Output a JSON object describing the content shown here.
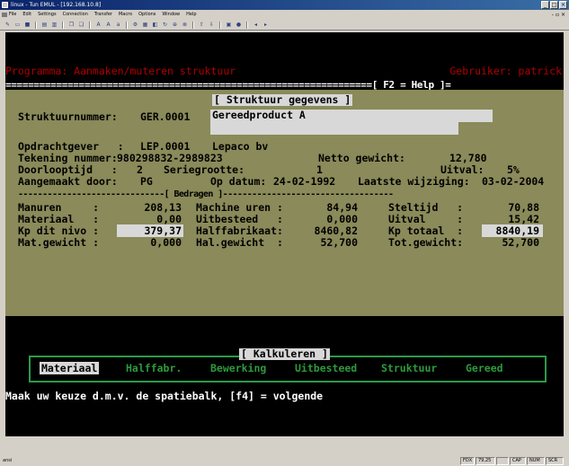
{
  "window": {
    "title": "linux - Tun EMUL - [192.168.10.8]",
    "min_label": "_",
    "max_label": "□",
    "close_label": "×"
  },
  "menubar": {
    "items": [
      "File",
      "Edit",
      "Settings",
      "Connection",
      "Transfer",
      "Macro",
      "Options",
      "Window",
      "Help"
    ],
    "mdi_controls": "- ▫ ×"
  },
  "toolbar": {
    "icons": [
      "new-icon",
      "open-icon",
      "save-icon",
      "print-icon",
      "print-preview-icon",
      "copy-icon",
      "paste-icon",
      "font-icon",
      "bigger-font-icon",
      "smaller-font-icon",
      "settings-icon",
      "keyboard-icon",
      "macro-icon",
      "refresh-icon",
      "connect-icon",
      "disconnect-icon",
      "transfer-icon",
      "receive-icon",
      "screen-icon",
      "record-icon",
      "prev-icon",
      "next-icon"
    ]
  },
  "terminal": {
    "program_line": "Programma: Aanmaken/muteren struktuur",
    "user_line": "Gebruiker: patrick",
    "sep_line": "=================================================================[ F2 = Help ]=",
    "panel_title": "[ Struktuur gegevens ]",
    "struktuur_label": "Struktuurnummer:",
    "struktuur_value": "GER.0001",
    "description": "Gereedproduct A",
    "opdrachtgever_label": "Opdrachtgever   :",
    "opdrachtgever_code": "LEP.0001",
    "opdrachtgever_name": "Lepaco bv",
    "tekening_label": "Tekening nummer:",
    "tekening_value": "980298832-2989823",
    "netto_label": "Netto gewicht:",
    "netto_value": "12,780",
    "doorloop_label": "Doorlooptijd   :",
    "doorloop_value": "2",
    "serie_label": "Seriegrootte:",
    "serie_value": "1",
    "uitval_label": "Uitval:",
    "uitval_value": "5%",
    "aangemaakt_label": "Aangemaakt door:",
    "aangemaakt_value": "PG",
    "datum_label": "Op datum:",
    "datum_value": "24-02-1992",
    "wijziging_label": "Laatste wijziging:",
    "wijziging_value": "03-02-2004",
    "bedragen_line": "------------------------------[ Bedragen ]-----------------------------------",
    "rows": [
      {
        "l1": "Manuren     :",
        "v1": "208,13",
        "l2": "Machine uren :",
        "v2": "84,94",
        "l3": "Steltijd   :",
        "v3": "70,88"
      },
      {
        "l1": "Materiaal   :",
        "v1": "0,00",
        "l2": "Uitbesteed   :",
        "v2": "0,000",
        "l3": "Uitval     :",
        "v3": "15,42"
      },
      {
        "l1": "Kp dit nivo :",
        "v1": "379,37",
        "l2": "Halffabrikaat:",
        "v2": "8460,82",
        "l3": "Kp totaal  :",
        "v3": "8840,19"
      },
      {
        "l1": "Mat.gewicht :",
        "v1": "0,000",
        "l2": "Hal.gewicht  :",
        "v2": "52,700",
        "l3": "Tot.gewicht:",
        "v3": "52,700"
      }
    ],
    "kalk_title": "[ Kalkuleren ]",
    "menu_items": [
      "Materiaal",
      "Halffabr.",
      "Bewerking",
      "Uitbesteed",
      "Struktuur",
      "Gereed"
    ],
    "prompt": "Maak uw keuze d.m.v. de spatiebalk, [f4] = volgende"
  },
  "statusbar": {
    "left": "ansi",
    "cells": [
      "FDX",
      "79,25",
      "",
      "CAP",
      "NUM",
      "SCR"
    ]
  }
}
